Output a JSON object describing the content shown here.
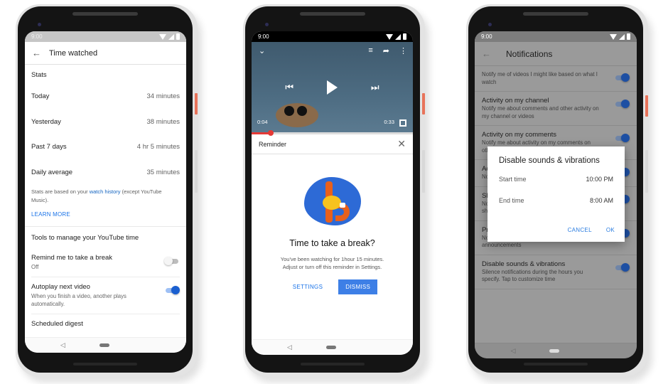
{
  "phone1": {
    "status_time": "9:00",
    "title": "Time watched",
    "stats_title": "Stats",
    "stats": [
      {
        "label": "Today",
        "value": "34 minutes"
      },
      {
        "label": "Yesterday",
        "value": "38 minutes"
      },
      {
        "label": "Past 7 days",
        "value": "4 hr 5 minutes"
      },
      {
        "label": "Daily average",
        "value": "35 minutes"
      }
    ],
    "note_prefix": "Stats are based on your ",
    "note_link": "watch history",
    "note_suffix": " (except YouTube Music).",
    "learn_more": "LEARN MORE",
    "tools_title": "Tools to manage your YouTube time",
    "settings": [
      {
        "title": "Remind me to take a break",
        "subtitle": "Off",
        "enabled": false
      },
      {
        "title": "Autoplay next video",
        "subtitle": "When you finish a video, another plays automatically.",
        "enabled": true
      },
      {
        "title": "Scheduled digest",
        "subtitle": "",
        "enabled": false
      }
    ]
  },
  "phone2": {
    "status_time": "9:00",
    "video": {
      "current_time": "0:04",
      "duration": "0:33",
      "progress": 0.12
    },
    "reminder_label": "Reminder",
    "break_title": "Time to take a break?",
    "break_msg_line1": "You've been watching for 1hour 15 minutes.",
    "break_msg_line2": "Adjust or turn off this reminder in Settings.",
    "settings_button": "SETTINGS",
    "dismiss_button": "DISMISS"
  },
  "phone3": {
    "status_time": "9:00",
    "title": "Notifications",
    "rows": [
      {
        "title": "",
        "subtitle": "Notify me of videos I might like based on what I watch",
        "enabled": true
      },
      {
        "title": "Activity on my channel",
        "subtitle": "Notify me about comments and other activity on my channel or videos",
        "enabled": true
      },
      {
        "title": "Activity on my comments",
        "subtitle": "Notify me about activity on my comments on other channels",
        "enabled": true
      },
      {
        "title": "Activity on my shared content",
        "subtitle": "Notify me about activity on content I shared",
        "enabled": true
      },
      {
        "title": "Shared with me",
        "subtitle": "Notify me when others share, or reply to my shared videos",
        "enabled": true
      },
      {
        "title": "Product updates",
        "subtitle": "Notify me of new product updates and announcements",
        "enabled": true
      },
      {
        "title": "Disable sounds & vibrations",
        "subtitle": "Silence notifications during the hours you specify.  Tap to customize time",
        "enabled": true
      }
    ],
    "dialog": {
      "title": "Disable sounds & vibrations",
      "start_label": "Start time",
      "start_value": "10:00 PM",
      "end_label": "End time",
      "end_value": "8:00 AM",
      "cancel": "CANCEL",
      "ok": "OK"
    }
  }
}
